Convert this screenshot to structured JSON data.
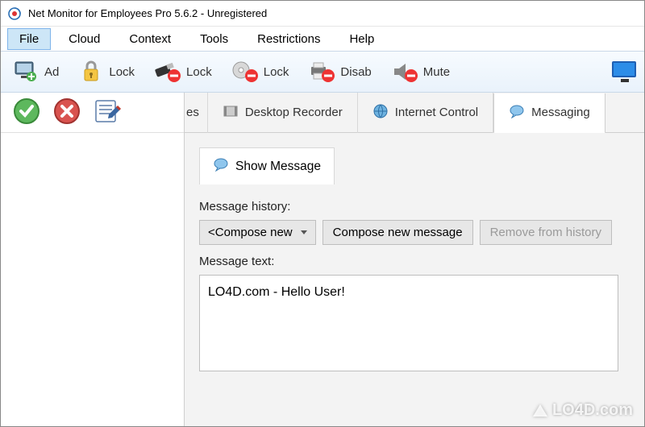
{
  "window": {
    "title": "Net Monitor for Employees Pro 5.6.2 - Unregistered"
  },
  "menu": {
    "items": [
      "File",
      "Cloud",
      "Context",
      "Tools",
      "Restrictions",
      "Help"
    ],
    "active_index": 0
  },
  "toolbar": {
    "add": "Ad",
    "lock1": "Lock",
    "lock2": "Lock",
    "lock3": "Lock",
    "disable": "Disab",
    "mute": "Mute"
  },
  "tabs": {
    "partial_label": "es",
    "items": [
      "Desktop Recorder",
      "Internet Control",
      "Messaging"
    ],
    "active_index": 2
  },
  "messaging": {
    "subtab": "Show Message",
    "history_label": "Message history:",
    "compose_selected": "<Compose new",
    "compose_button": "Compose new message",
    "remove_button": "Remove from history",
    "text_label": "Message text:",
    "text_value": "LO4D.com - Hello User!"
  },
  "watermark": "LO4D.com"
}
